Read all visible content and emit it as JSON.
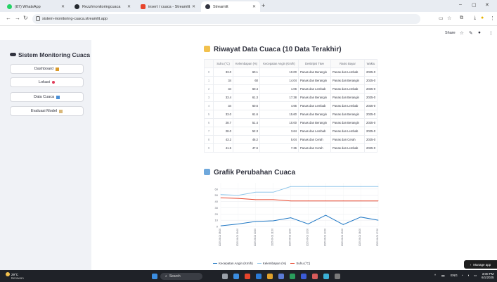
{
  "browser": {
    "tabs": [
      {
        "label": "(87) WhatsApp",
        "color": "#25d366",
        "active": false
      },
      {
        "label": "Rezz/monitoringcuaca",
        "color": "#24292f",
        "active": false
      },
      {
        "label": "insert / cuaca - Streamlit",
        "color": "#e8452c",
        "active": false
      },
      {
        "label": "Streamlit",
        "color": "#ff4b4b",
        "active": true
      }
    ],
    "url": "sistem-monitoring-cuaca.streamlit.app"
  },
  "header": {
    "share_label": "Share"
  },
  "sidebar": {
    "title": "Sistem Monitoring Cuaca",
    "buttons": [
      "Dashboard",
      "Lokasi",
      "Data Cuaca",
      "Evaluasi Model"
    ]
  },
  "main": {
    "table_title": "Riwayat Data Cuaca (10 Data Terakhir)",
    "chart_title": "Grafik Perubahan Cuaca"
  },
  "table": {
    "columns": [
      "",
      "Suhu (°C)",
      "Kelembapan (%)",
      "Kecepatan Angin (Km/h)",
      "Deskripsi Tiwe",
      "Rasio Bayar",
      "Waktu"
    ],
    "rows": [
      [
        "0",
        "33.0",
        "60.1",
        "10.00",
        "Panas dan Berangin",
        "Panas dan Lembab",
        "2025-0"
      ],
      [
        "1",
        "34",
        "60",
        "14.04",
        "Panas dan Berangin",
        "Panas dan Berangin",
        "2025-0"
      ],
      [
        "2",
        "34",
        "60.4",
        "1.06",
        "Panas dan Lembab",
        "Panas dan Lembab",
        "2025-0"
      ],
      [
        "3",
        "33.4",
        "61.3",
        "17.38",
        "Panas dan Berangin",
        "Panas dan Berangin",
        "2025-0"
      ],
      [
        "4",
        "34",
        "60.6",
        "4.66",
        "Panas dan Lembab",
        "Panas dan Lembab",
        "2025-0"
      ],
      [
        "5",
        "33.0",
        "61.6",
        "15.60",
        "Panas dan Berangin",
        "Panas dan Berangin",
        "2025-0"
      ],
      [
        "6",
        "28.7",
        "51.4",
        "10.00",
        "Panas dan Berangin",
        "Panas dan Berangin",
        "2025-0"
      ],
      [
        "7",
        "28.0",
        "52.3",
        "3.64",
        "Panas dan Lembab",
        "Panas dan Lembab",
        "2025-0"
      ],
      [
        "8",
        "43.2",
        "46.2",
        "5.04",
        "Panas dan Cerah",
        "Panas dan Cerah",
        "2025-0"
      ],
      [
        "9",
        "41.5",
        "47.6",
        "7.36",
        "Panas dan Cerah",
        "Panas dan Lembab",
        "2025-0"
      ]
    ]
  },
  "chart_data": {
    "type": "line",
    "x": [
      "2025-06-01 08:00",
      "2025-06-01 09:00",
      "2025-06-01 10:00",
      "2025-06-01 11:00",
      "2025-06-01 12:00",
      "2025-06-01 13:00",
      "2025-06-01 14:00",
      "2025-06-01 15:00",
      "2025-06-01 16:00",
      "2025-06-01 17:00"
    ],
    "ylim": [
      0,
      70
    ],
    "yticks": [
      0,
      10,
      20,
      30,
      40,
      50,
      60
    ],
    "series": [
      {
        "name": "Kecepatan Angin (Km/h)",
        "color": "#1f77c4",
        "values": [
          1,
          4,
          8,
          9,
          14,
          4,
          18,
          3,
          15,
          10
        ]
      },
      {
        "name": "Kelembapan (%)",
        "color": "#8fc6ea",
        "values": [
          51,
          50,
          55,
          55,
          64,
          64,
          64,
          64,
          64,
          64
        ]
      },
      {
        "name": "Suhu (°C)",
        "color": "#e8452c",
        "values": [
          46,
          45,
          43,
          43,
          41,
          41,
          41,
          41,
          41,
          41
        ]
      }
    ],
    "grid": true,
    "legend_position": "bottom"
  },
  "manage_app_label": "Manage app",
  "taskbar": {
    "weather_temp": "29°C",
    "weather_desc": "Berawan",
    "search_label": "Search",
    "lang": "ENG",
    "time": "3:00 PM",
    "date": "6/1/2025"
  }
}
